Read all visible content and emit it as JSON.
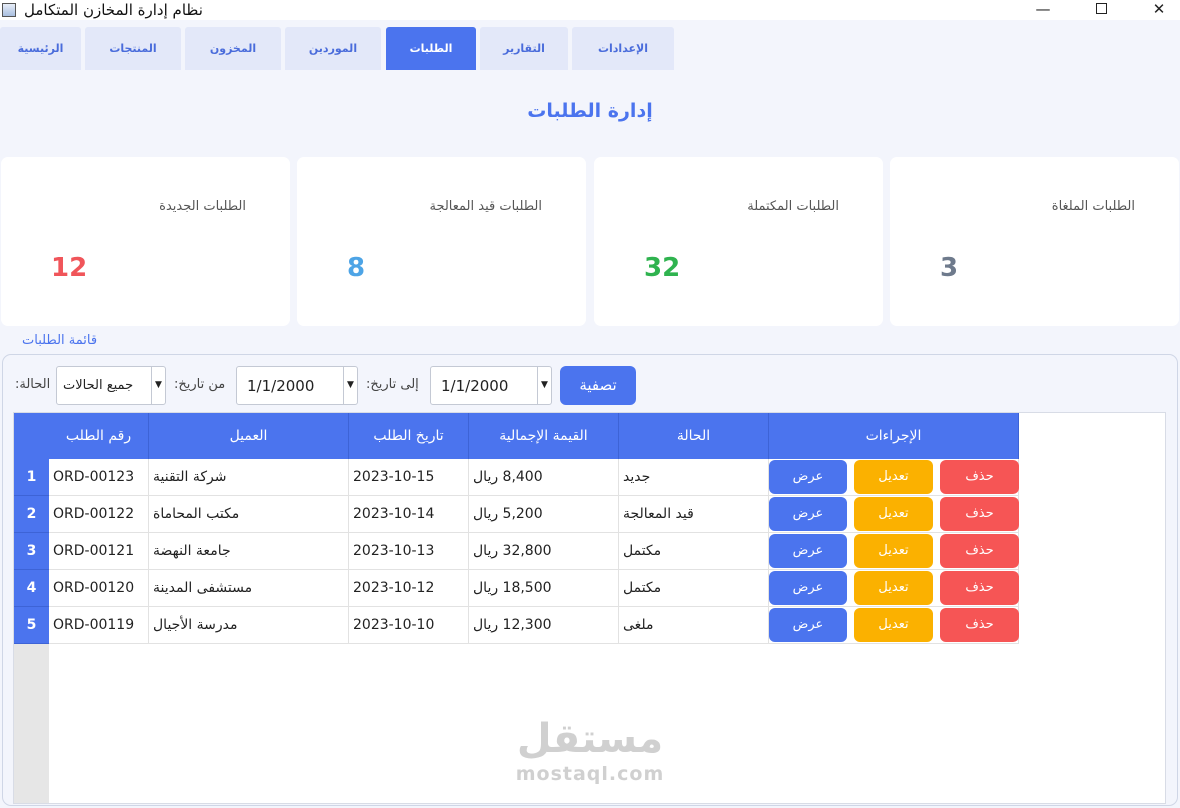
{
  "window": {
    "title": "نظام إدارة المخازن المتكامل",
    "minimize": "—",
    "close": "✕"
  },
  "tabs": [
    "الرئيسية",
    "المنتجات",
    "المخزون",
    "الموردين",
    "الطلبات",
    "التقارير",
    "الإعدادات"
  ],
  "active_tab": "الطلبات",
  "page_title": "إدارة الطلبات",
  "stats": [
    {
      "label": "الطلبات الجديدة",
      "value": "12",
      "color": "#f0555a"
    },
    {
      "label": "الطلبات قيد المعالجة",
      "value": "8",
      "color": "#4da4e6"
    },
    {
      "label": "الطلبات المكتملة",
      "value": "32",
      "color": "#2fb34f"
    },
    {
      "label": "الطلبات الملغاة",
      "value": "3",
      "color": "#6e7a8c"
    }
  ],
  "section_label": "قائمة الطلبات",
  "filters": {
    "status_label": "الحالة:",
    "status_value": "جميع الحالات",
    "from_label": "من تاريخ:",
    "from_value": "1/1/2000",
    "to_label": "إلى تاريخ:",
    "to_value": "1/1/2000",
    "filter_button": "تصفية"
  },
  "table": {
    "columns": [
      "رقم الطلب",
      "العميل",
      "تاريخ الطلب",
      "القيمة الإجمالية",
      "الحالة",
      "الإجراءات"
    ],
    "rows": [
      {
        "num": "1",
        "id": "ORD-00123",
        "customer": "شركة التقنية",
        "date": "2023-10-15",
        "total": "8,400 ريال",
        "status": "جديد"
      },
      {
        "num": "2",
        "id": "ORD-00122",
        "customer": "مكتب المحاماة",
        "date": "2023-10-14",
        "total": "5,200 ريال",
        "status": "قيد المعالجة"
      },
      {
        "num": "3",
        "id": "ORD-00121",
        "customer": "جامعة النهضة",
        "date": "2023-10-13",
        "total": "32,800 ريال",
        "status": "مكتمل"
      },
      {
        "num": "4",
        "id": "ORD-00120",
        "customer": "مستشفى المدينة",
        "date": "2023-10-12",
        "total": "18,500 ريال",
        "status": "مكتمل"
      },
      {
        "num": "5",
        "id": "ORD-00119",
        "customer": "مدرسة الأجيال",
        "date": "2023-10-10",
        "total": "12,300 ريال",
        "status": "ملغى"
      }
    ],
    "actions": {
      "view": "عرض",
      "edit": "تعديل",
      "delete": "حذف"
    }
  },
  "watermark": {
    "arabic": "مستقل",
    "latin": "mostaql.com"
  }
}
